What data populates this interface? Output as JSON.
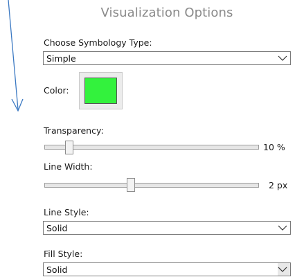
{
  "panel": {
    "title": "Visualization Options"
  },
  "symbology": {
    "label": "Choose Symbology Type:",
    "value": "Simple"
  },
  "color": {
    "label": "Color:",
    "value": "#33f23d"
  },
  "transparency": {
    "label": "Transparency:",
    "value": 10,
    "readout": "10 %",
    "max": 100
  },
  "line_width": {
    "label": "Line Width:",
    "value": 2,
    "readout": "2 px",
    "max": 5
  },
  "line_style": {
    "label": "Line Style:",
    "value": "Solid"
  },
  "fill_style": {
    "label": "Fill Style:",
    "value": "Solid"
  },
  "icons": {
    "pointer": "down-arrow-icon",
    "dropdown": "chevron-down-icon"
  },
  "colors": {
    "accent_arrow": "#3a78c2",
    "title_gray": "#8a8a8a"
  }
}
